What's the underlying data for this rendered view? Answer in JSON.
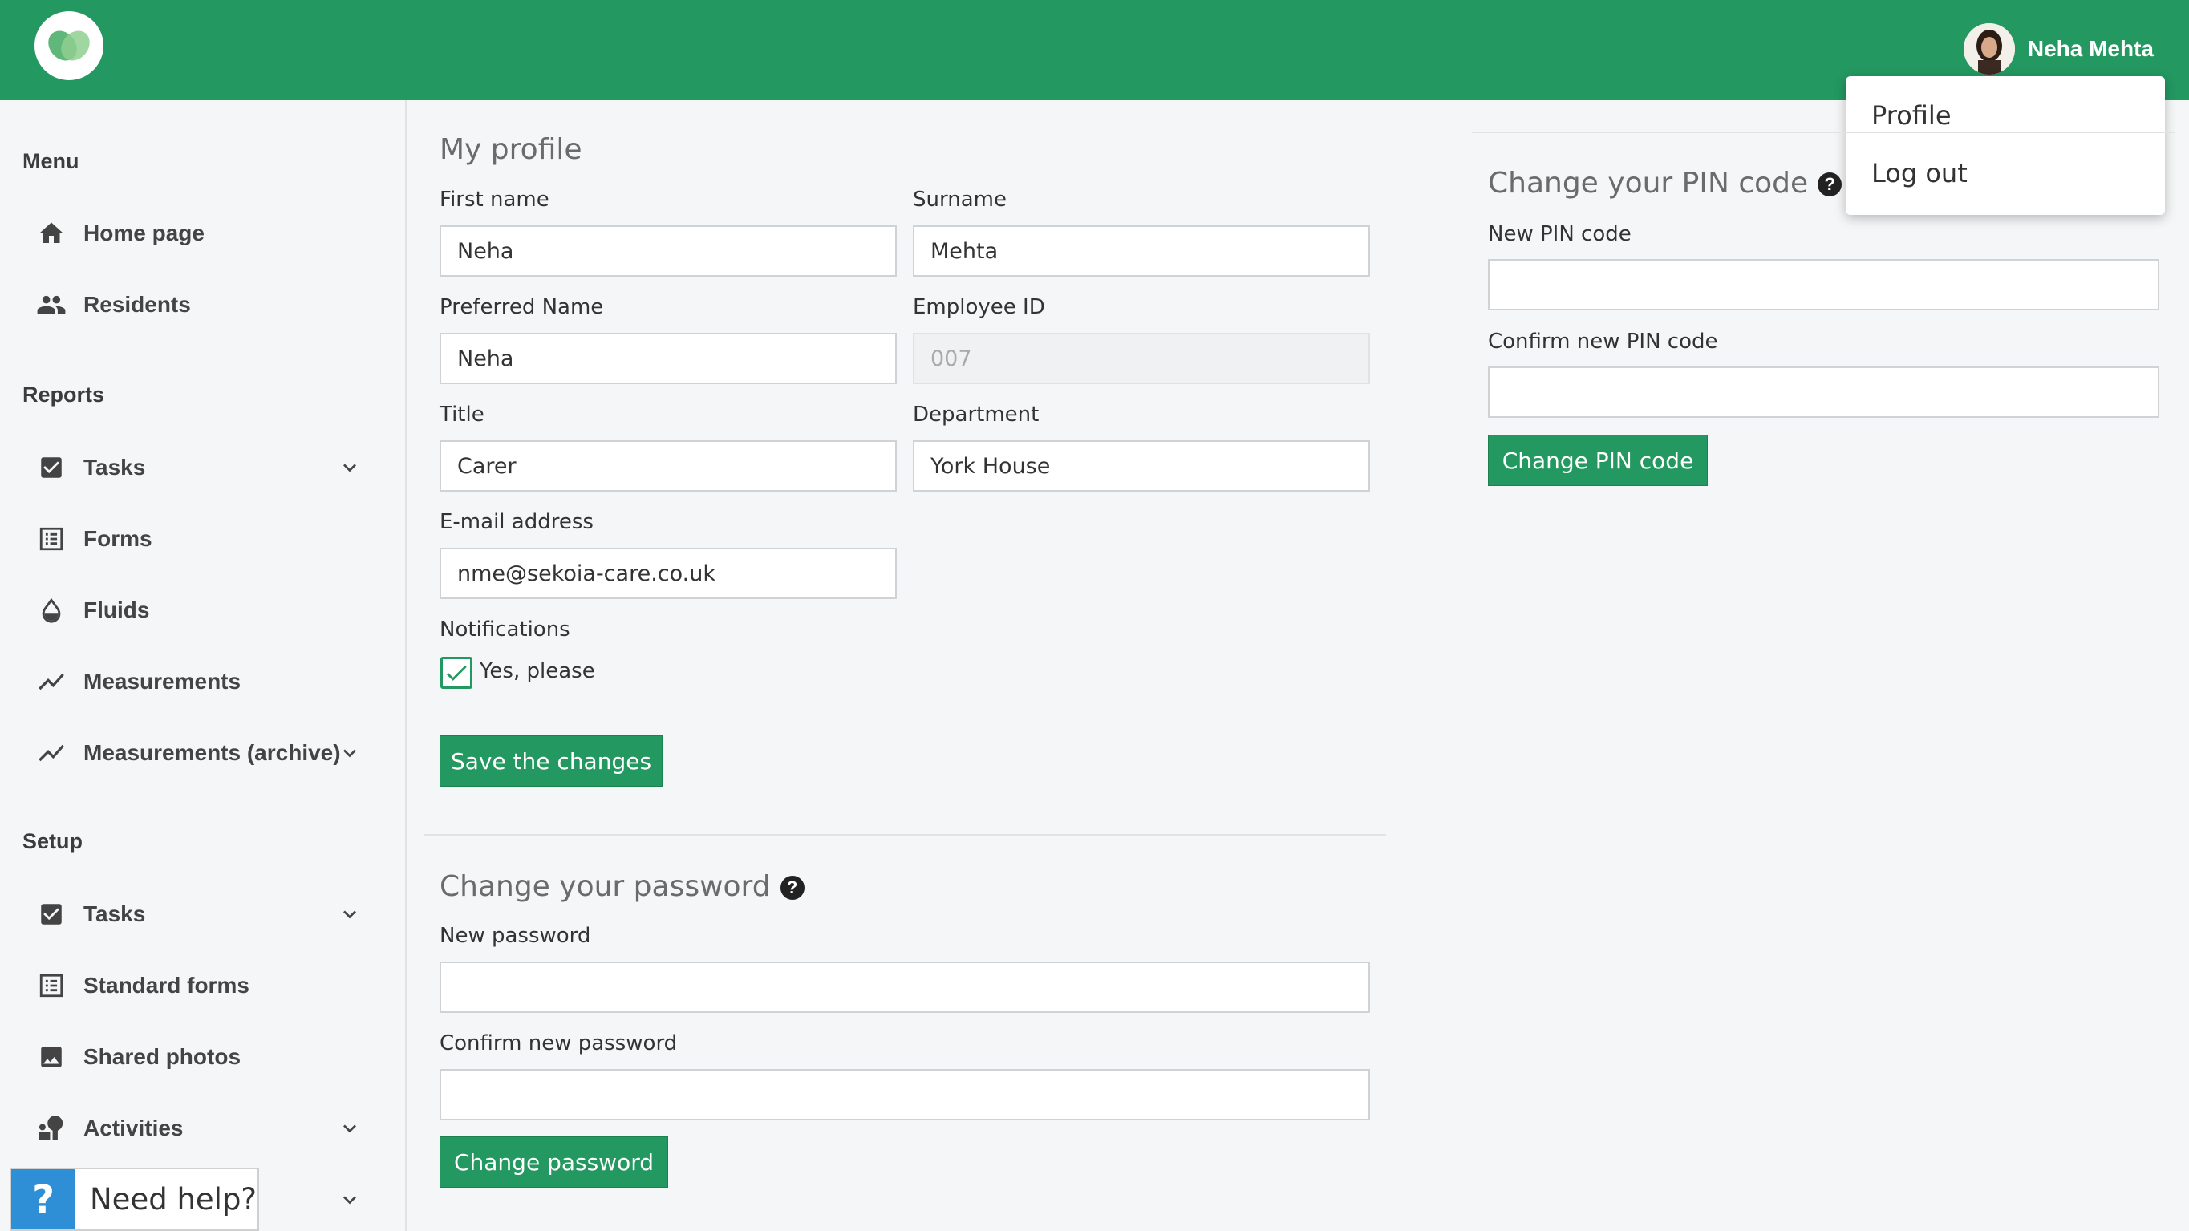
{
  "colors": {
    "brand": "#239860",
    "help": "#2e8fd6"
  },
  "header": {
    "user_name": "Neha Mehta"
  },
  "dropdown": {
    "items": [
      "Profile",
      "Log out"
    ]
  },
  "sidebar": {
    "menu_head": "Menu",
    "reports_head": "Reports",
    "setup_head": "Setup",
    "menu_items": [
      {
        "label": "Home page",
        "icon": "home-icon"
      },
      {
        "label": "Residents",
        "icon": "people-icon"
      }
    ],
    "report_items": [
      {
        "label": "Tasks",
        "icon": "checkbox-icon",
        "expandable": true
      },
      {
        "label": "Forms",
        "icon": "list-icon"
      },
      {
        "label": "Fluids",
        "icon": "drop-icon"
      },
      {
        "label": "Measurements",
        "icon": "trend-icon"
      },
      {
        "label": "Measurements (archive)",
        "icon": "trend-icon",
        "expandable": true
      }
    ],
    "setup_items": [
      {
        "label": "Tasks",
        "icon": "checkbox-icon",
        "expandable": true
      },
      {
        "label": "Standard forms",
        "icon": "list-icon"
      },
      {
        "label": "Shared photos",
        "icon": "image-icon"
      },
      {
        "label": "Activities",
        "icon": "activity-icon",
        "expandable": true
      }
    ],
    "help": {
      "icon": "?",
      "label": "Need help?"
    }
  },
  "profile": {
    "title": "My profile",
    "first_name_label": "First name",
    "first_name": "Neha",
    "surname_label": "Surname",
    "surname": "Mehta",
    "preferred_label": "Preferred Name",
    "preferred": "Neha",
    "employee_id_label": "Employee ID",
    "employee_id": "007",
    "title_label": "Title",
    "title_value": "Carer",
    "department_label": "Department",
    "department": "York House",
    "email_label": "E-mail address",
    "email": "nme@sekoia-care.co.uk",
    "notifications_label": "Notifications",
    "notifications_option": "Yes, please",
    "notifications_checked": true,
    "save_label": "Save the changes"
  },
  "password": {
    "title": "Change your password",
    "new_label": "New password",
    "confirm_label": "Confirm new password",
    "button": "Change password"
  },
  "pin": {
    "title": "Change your PIN code",
    "new_label": "New PIN code",
    "confirm_label": "Confirm new PIN code",
    "button": "Change PIN code"
  }
}
